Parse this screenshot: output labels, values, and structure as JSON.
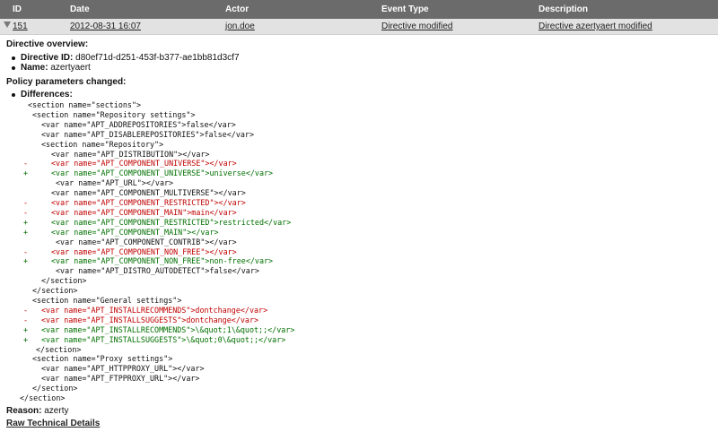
{
  "header": {
    "id": "ID",
    "date": "Date",
    "actor": "Actor",
    "event_type": "Event Type",
    "description": "Description"
  },
  "row": {
    "id": "151",
    "date": "2012-08-31 16:07",
    "actor": "jon.doe",
    "event_type": "Directive modified",
    "description": "Directive azertyaert modified"
  },
  "overview": {
    "title": "Directive overview:",
    "id_label": "Directive ID:",
    "id_value": "d80ef71d-d251-453f-b377-ae1bb81d3cf7",
    "name_label": "Name:",
    "name_value": "azertyaert"
  },
  "params": {
    "title": "Policy parameters changed:",
    "diff_label": "Differences:"
  },
  "diff_lines": [
    {
      "m": "",
      "t": "n",
      "x": 31,
      "text": "<section name=\"sections\">"
    },
    {
      "m": "",
      "t": "n",
      "x": 36,
      "text": "<section name=\"Repository settings\">"
    },
    {
      "m": "",
      "t": "n",
      "x": 46,
      "text": "<var name=\"APT_ADDREPOSITORIES\">false</var>"
    },
    {
      "m": "",
      "t": "n",
      "x": 46,
      "text": "<var name=\"APT_DISABLEREPOSITORIES\">false</var>"
    },
    {
      "m": "",
      "t": "n",
      "x": 46,
      "text": "<section name=\"Repository\">"
    },
    {
      "m": "",
      "t": "n",
      "x": 57,
      "text": "<var name=\"APT_DISTRIBUTION\"></var>"
    },
    {
      "m": "-",
      "t": "r",
      "x": 57,
      "text": "<var name=\"APT_COMPONENT_UNIVERSE\"></var>"
    },
    {
      "m": "+",
      "t": "g",
      "x": 57,
      "text": "<var name=\"APT_COMPONENT_UNIVERSE\">universe</var>"
    },
    {
      "m": "",
      "t": "n",
      "x": 62,
      "text": "<var name=\"APT_URL\"></var>"
    },
    {
      "m": "",
      "t": "n",
      "x": 57,
      "text": "<var name=\"APT_COMPONENT_MULTIVERSE\"></var>"
    },
    {
      "m": "-",
      "t": "r",
      "x": 57,
      "text": "<var name=\"APT_COMPONENT_RESTRICTED\"></var>"
    },
    {
      "m": "-",
      "t": "r",
      "x": 57,
      "text": "<var name=\"APT_COMPONENT_MAIN\">main</var>"
    },
    {
      "m": "+",
      "t": "g",
      "x": 57,
      "text": "<var name=\"APT_COMPONENT_RESTRICTED\">restricted</var>"
    },
    {
      "m": "+",
      "t": "g",
      "x": 57,
      "text": "<var name=\"APT_COMPONENT_MAIN\"></var>"
    },
    {
      "m": "",
      "t": "n",
      "x": 62,
      "text": "<var name=\"APT_COMPONENT_CONTRIB\"></var>"
    },
    {
      "m": "-",
      "t": "r",
      "x": 57,
      "text": "<var name=\"APT_COMPONENT_NON_FREE\"></var>"
    },
    {
      "m": "+",
      "t": "g",
      "x": 57,
      "text": "<var name=\"APT_COMPONENT_NON_FREE\">non-free</var>"
    },
    {
      "m": "",
      "t": "n",
      "x": 62,
      "text": "<var name=\"APT_DISTRO_AUTODETECT\">false</var>"
    },
    {
      "m": "",
      "t": "n",
      "x": 46,
      "text": "</section>"
    },
    {
      "m": "",
      "t": "n",
      "x": 36,
      "text": "</section>"
    },
    {
      "m": "",
      "t": "n",
      "x": 36,
      "text": "<section name=\"General settings\">"
    },
    {
      "m": "-",
      "t": "r",
      "x": 46,
      "text": "<var name=\"APT_INSTALLRECOMMENDS\">dontchange</var>"
    },
    {
      "m": "-",
      "t": "r",
      "x": 46,
      "text": "<var name=\"APT_INSTALLSUGGESTS\">dontchange</var>"
    },
    {
      "m": "+",
      "t": "g",
      "x": 46,
      "text": "<var name=\"APT_INSTALLRECOMMENDS\">\\&quot;1\\&quot;;</var>"
    },
    {
      "m": "+",
      "t": "g",
      "x": 46,
      "text": "<var name=\"APT_INSTALLSUGGESTS\">\\&quot;0\\&quot;;</var>"
    },
    {
      "m": "",
      "t": "n",
      "x": 40,
      "text": "</section>"
    },
    {
      "m": "",
      "t": "n",
      "x": 36,
      "text": "<section name=\"Proxy settings\">"
    },
    {
      "m": "",
      "t": "n",
      "x": 46,
      "text": "<var name=\"APT_HTTPPROXY_URL\"></var>"
    },
    {
      "m": "",
      "t": "n",
      "x": 46,
      "text": "<var name=\"APT_FTPPROXY_URL\"></var>"
    },
    {
      "m": "",
      "t": "n",
      "x": 36,
      "text": "</section>"
    },
    {
      "m": "",
      "t": "n",
      "x": 22,
      "text": "</section>"
    }
  ],
  "reason": {
    "label": "Reason:",
    "value": "azerty"
  },
  "raw_link": "Raw Technical Details"
}
